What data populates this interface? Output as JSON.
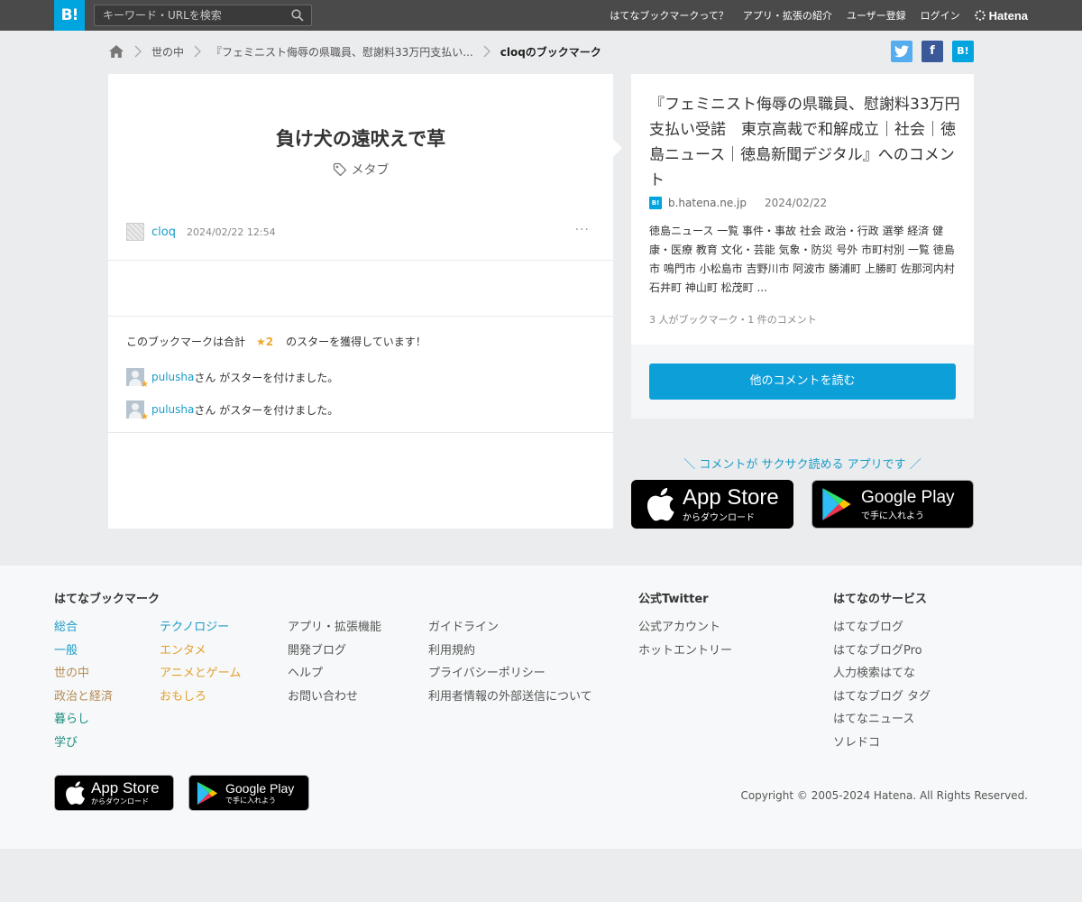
{
  "header": {
    "logo": "B!",
    "search_placeholder": "キーワード・URLを検索",
    "nav": [
      "はてなブックマークって？",
      "アプリ・拡張の紹介",
      "ユーザー登録",
      "ログイン"
    ],
    "brand": "Hatena"
  },
  "breadcrumb": {
    "items": [
      "世の中",
      "『フェミニスト侮辱の県職員、慰謝料33万円支払い..."
    ],
    "current": "cloqのブックマーク"
  },
  "share": {
    "twitter": "t",
    "facebook": "f",
    "hatena": "B!"
  },
  "bookmark": {
    "comment": "負け犬の遠吠えで草",
    "tag": "メタブ",
    "user": "cloq",
    "datetime": "2024/02/22 12:54",
    "more": "···",
    "star_summary_prefix": "このブックマークは合計",
    "star_count": "★2",
    "star_summary_suffix": "のスターを獲得しています！",
    "stars": [
      {
        "user": "pulusha",
        "text": "さん がスターを付けました。"
      },
      {
        "user": "pulusha",
        "text": "さん がスターを付けました。"
      }
    ]
  },
  "entry": {
    "title": "『フェミニスト侮辱の県職員、慰謝料33万円支払い受諾　東京高裁で和解成立｜社会｜徳島ニュース｜徳島新聞デジタル』へのコメント",
    "favicon": "B!",
    "domain": "b.hatena.ne.jp",
    "date": "2024/02/22",
    "summary": "徳島ニュース 一覧 事件・事故 社会 政治・行政 選挙 経済 健康・医療 教育 文化・芸能 気象・防災 号外 市町村別 一覧 徳島市 鳴門市 小松島市 吉野川市 阿波市 勝浦町 上勝町 佐那河内村 石井町 神山町 松茂町 ...",
    "stats": "3 人がブックマーク・1 件のコメント",
    "read_more": "他のコメントを読む"
  },
  "app_promo": {
    "text": "＼ コメントが サクサク読める アプリです ／",
    "appstore_main": "App Store",
    "appstore_sub": "からダウンロード",
    "googleplay_main": "Google Play",
    "googleplay_sub": "で手に入れよう"
  },
  "footer": {
    "col1_title": "はてなブックマーク",
    "categories_a": [
      "総合",
      "一般",
      "世の中",
      "政治と経済",
      "暮らし",
      "学び"
    ],
    "categories_b": [
      "テクノロジー",
      "エンタメ",
      "アニメとゲーム",
      "おもしろ"
    ],
    "links_c": [
      "アプリ・拡張機能",
      "開発ブログ",
      "ヘルプ",
      "お問い合わせ"
    ],
    "links_d": [
      "ガイドライン",
      "利用規約",
      "プライバシーポリシー",
      "利用者情報の外部送信について"
    ],
    "twitter_title": "公式Twitter",
    "twitter_links": [
      "公式アカウント",
      "ホットエントリー"
    ],
    "services_title": "はてなのサービス",
    "services": [
      "はてなブログ",
      "はてなブログPro",
      "人力検索はてな",
      "はてなブログ タグ",
      "はてなニュース",
      "ソレドコ"
    ],
    "copyright": "Copyright © 2005-2024 Hatena. All Rights Reserved."
  },
  "colors": {
    "accent": "#00a4de",
    "topbar": "#4a4a4a",
    "link": "#1a9bc8",
    "star": "#f0a830"
  }
}
